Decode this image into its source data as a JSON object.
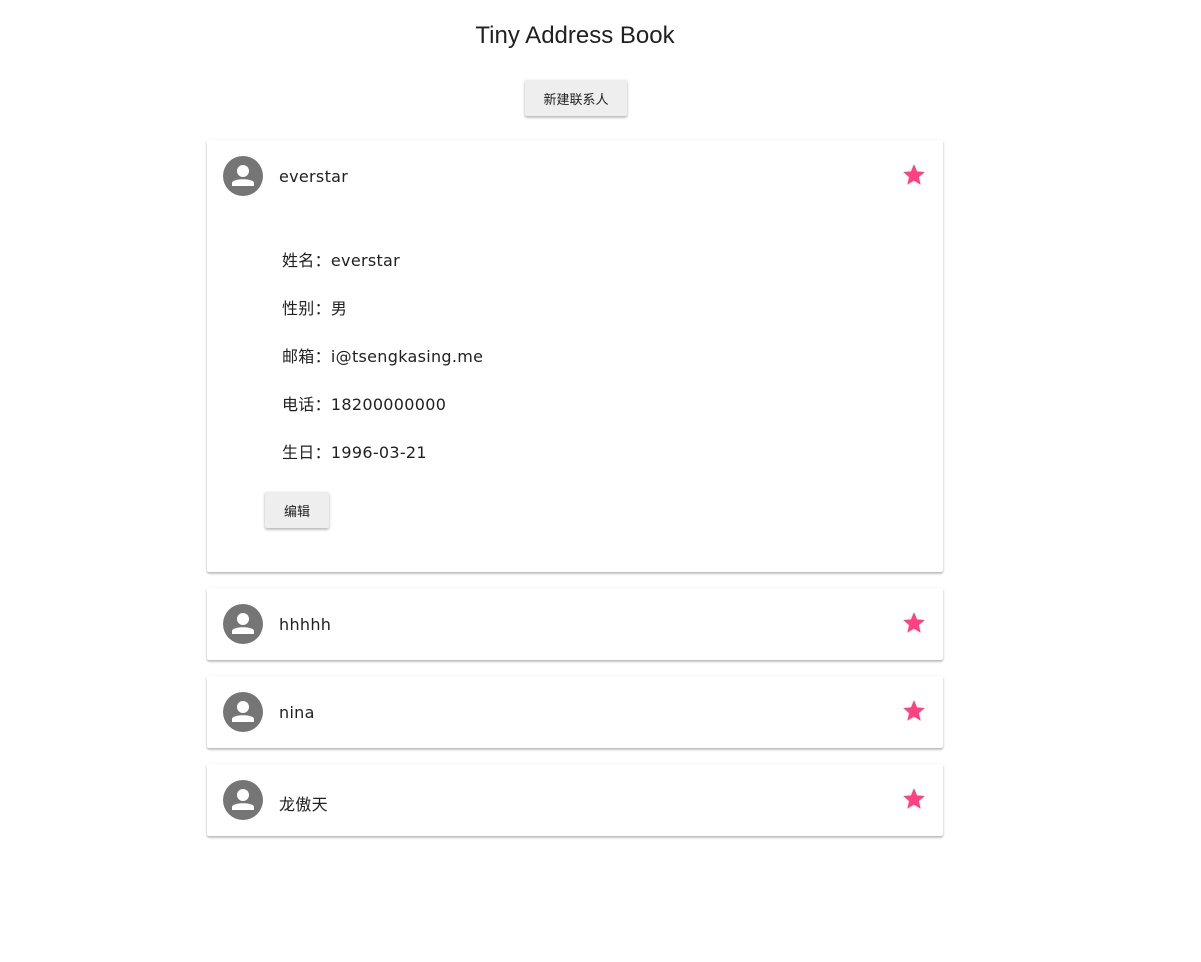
{
  "app": {
    "title": "Tiny Address Book",
    "new_contact_label": "新建联系人"
  },
  "colors": {
    "star": "#ff4081",
    "avatar": "#757575",
    "button_bg": "#eeeeee"
  },
  "contacts": [
    {
      "name": "everstar",
      "starred": true,
      "expanded": true,
      "details": [
        "姓名：everstar",
        "性别：男",
        "邮箱：i@tsengkasing.me",
        "电话：18200000000",
        "生日：1996-03-21"
      ],
      "edit_label": "编辑"
    },
    {
      "name": "hhhhh",
      "starred": true,
      "expanded": false
    },
    {
      "name": "nina",
      "starred": true,
      "expanded": false
    },
    {
      "name": "龙傲天",
      "starred": true,
      "expanded": false
    }
  ],
  "icons": {
    "avatar": "person-icon",
    "star": "star-icon"
  }
}
